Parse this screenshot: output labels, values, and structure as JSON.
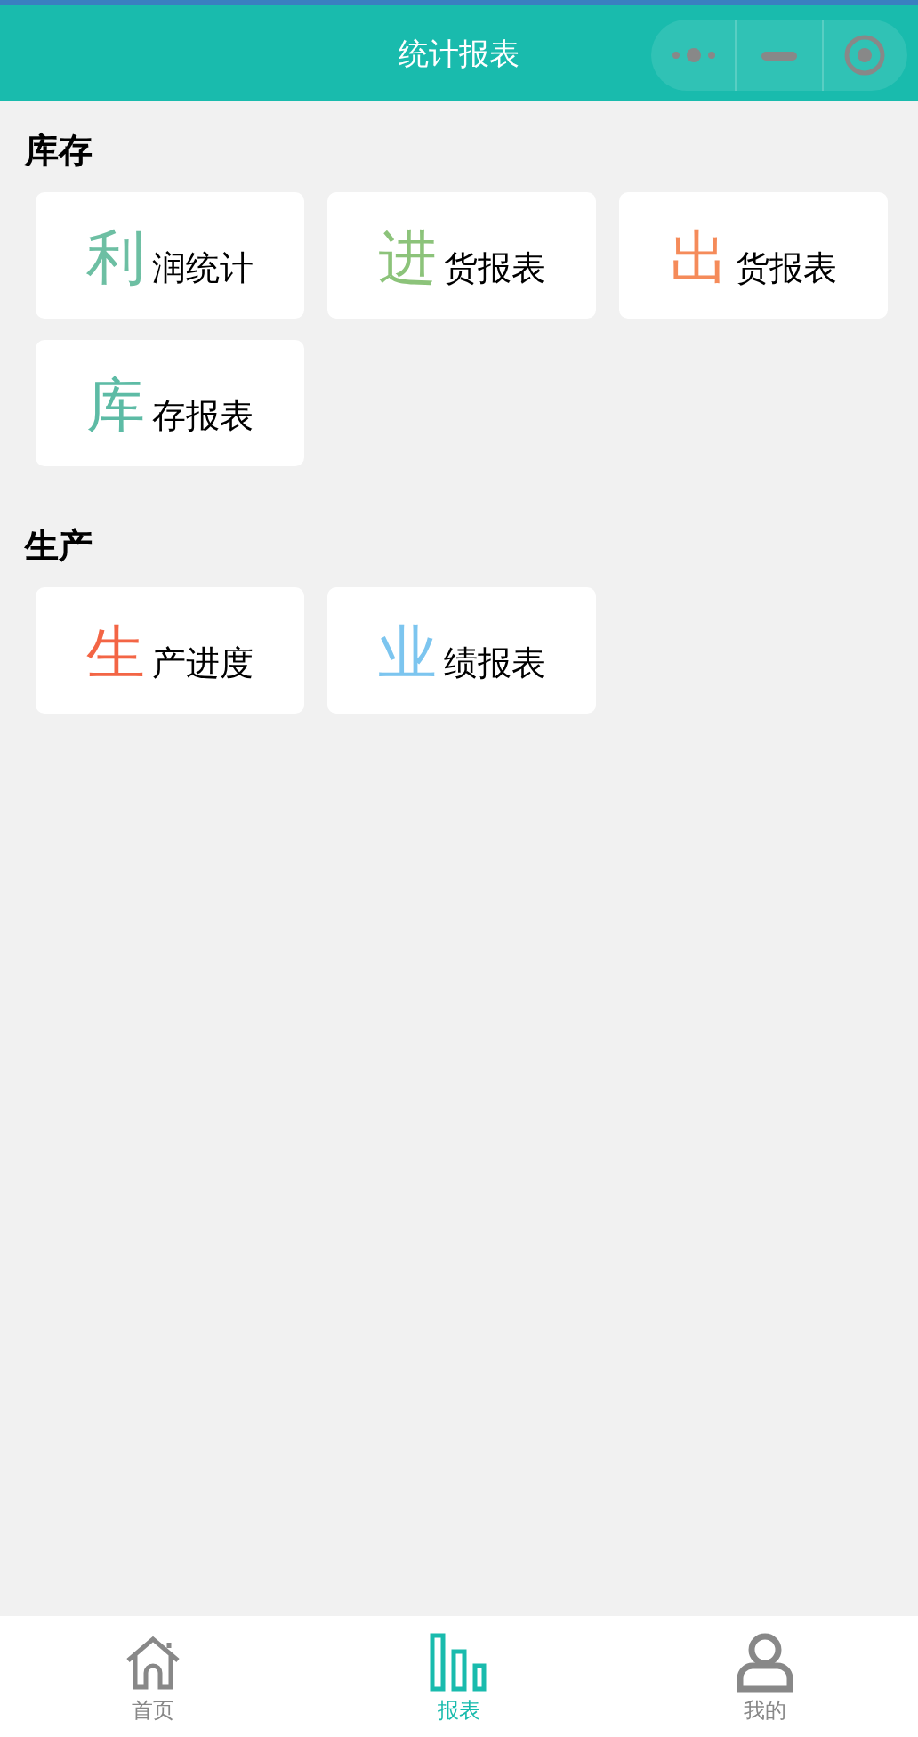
{
  "navbar": {
    "title": "统计报表"
  },
  "sections": [
    {
      "title": "库存",
      "items": [
        {
          "lead": "利",
          "rest": "润统计",
          "color": "#6dbfa3"
        },
        {
          "lead": "进",
          "rest": "货报表",
          "color": "#8cc37a"
        },
        {
          "lead": "出",
          "rest": "货报表",
          "color": "#f58b5a"
        },
        {
          "lead": "库",
          "rest": "存报表",
          "color": "#5dbba5"
        }
      ]
    },
    {
      "title": "生产",
      "items": [
        {
          "lead": "生",
          "rest": "产进度",
          "color": "#f36545"
        },
        {
          "lead": "业",
          "rest": "绩报表",
          "color": "#7cc5ef"
        }
      ]
    }
  ],
  "tabs": [
    {
      "kind": "home",
      "label": "首页",
      "selected": false
    },
    {
      "kind": "reports",
      "label": "报表",
      "selected": true
    },
    {
      "kind": "profile",
      "label": "我的",
      "selected": false
    }
  ]
}
